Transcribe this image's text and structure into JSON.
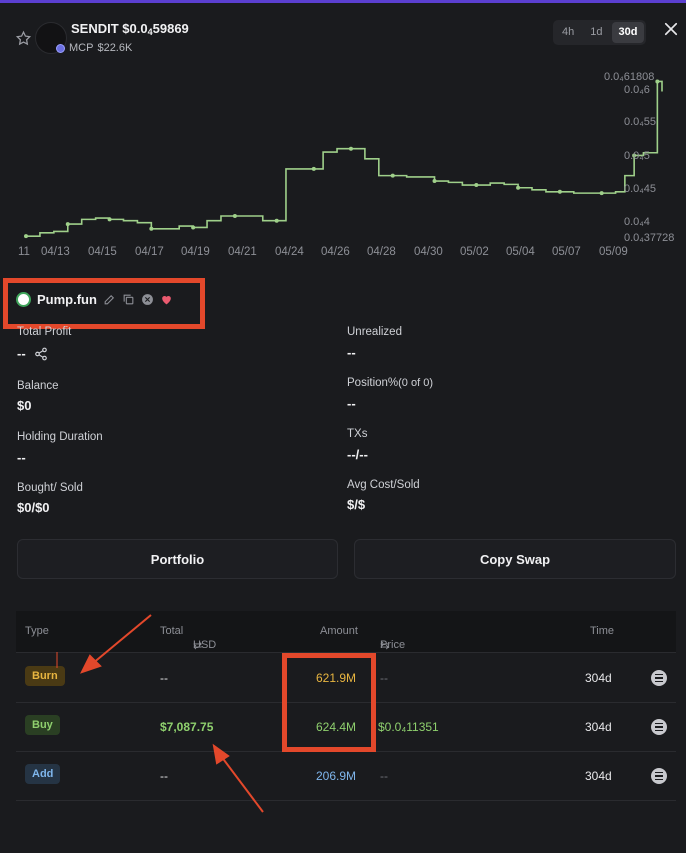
{
  "header": {
    "token_name": "SENDIT",
    "price_prefix": "$0.0",
    "price_sub": "4",
    "price_rest": "59869",
    "mcp_label": "MCP",
    "mcp_value": "$22.6K"
  },
  "timeframes": [
    {
      "label": "4h",
      "active": false
    },
    {
      "label": "1d",
      "active": false
    },
    {
      "label": "30d",
      "active": true
    }
  ],
  "chart_data": {
    "type": "line",
    "x_tick_labels": [
      "11",
      "04/13",
      "04/15",
      "04/17",
      "04/19",
      "04/21",
      "04/24",
      "04/26",
      "04/28",
      "04/30",
      "05/02",
      "05/04",
      "05/07",
      "05/09"
    ],
    "y_tick_labels": [
      "0.0₄61808",
      "0.0₄6",
      "0.0₄55",
      "0.0₄5",
      "0.0₄45",
      "0.0₄4",
      "0.0₄37728"
    ],
    "ylim": [
      3.773e-05,
      6.181e-05
    ],
    "points": [
      [
        0,
        3.8e-05
      ],
      [
        3,
        3.85e-05
      ],
      [
        6,
        3.87e-05
      ],
      [
        9,
        3.98e-05
      ],
      [
        12,
        4.05e-05
      ],
      [
        15,
        4.07e-05
      ],
      [
        18,
        4.05e-05
      ],
      [
        21,
        4.03e-05
      ],
      [
        24,
        4e-05
      ],
      [
        27,
        3.91e-05
      ],
      [
        30,
        3.91e-05
      ],
      [
        33,
        3.95e-05
      ],
      [
        36,
        3.93e-05
      ],
      [
        39,
        4.03e-05
      ],
      [
        42,
        4.1e-05
      ],
      [
        45,
        4.1e-05
      ],
      [
        48,
        4.1e-05
      ],
      [
        51,
        4.03e-05
      ],
      [
        54,
        4.03e-05
      ],
      [
        56,
        4.8e-05
      ],
      [
        59,
        4.8e-05
      ],
      [
        62,
        4.8e-05
      ],
      [
        64,
        5.05e-05
      ],
      [
        67,
        5.1e-05
      ],
      [
        70,
        5.1e-05
      ],
      [
        73,
        4.95e-05
      ],
      [
        76,
        4.7e-05
      ],
      [
        79,
        4.7e-05
      ],
      [
        82,
        4.68e-05
      ],
      [
        85,
        4.68e-05
      ],
      [
        88,
        4.62e-05
      ],
      [
        91,
        4.6e-05
      ],
      [
        94,
        4.56e-05
      ],
      [
        97,
        4.56e-05
      ],
      [
        100,
        4.59e-05
      ],
      [
        103,
        4.57e-05
      ],
      [
        106,
        4.52e-05
      ],
      [
        109,
        4.49e-05
      ],
      [
        112,
        4.46e-05
      ],
      [
        115,
        4.46e-05
      ],
      [
        118,
        4.44e-05
      ],
      [
        121,
        4.44e-05
      ],
      [
        124,
        4.44e-05
      ],
      [
        127,
        4.46e-05
      ],
      [
        129,
        4.7e-05
      ],
      [
        131,
        5e-05
      ],
      [
        133,
        5.04e-05
      ],
      [
        135,
        5.04e-05
      ],
      [
        136,
        6.1e-05
      ],
      [
        137,
        5.95e-05
      ]
    ],
    "line_color": "#9fd08a",
    "grid": false
  },
  "platform": {
    "name": "Pump.fun"
  },
  "stats": {
    "total_profit_label": "Total Profit",
    "total_profit_value": "--",
    "unrealized_label": "Unrealized",
    "unrealized_value": "--",
    "balance_label": "Balance",
    "balance_value": "$0",
    "position_label": "Position%",
    "position_sub": "(0 of 0)",
    "position_value": "--",
    "holding_label": "Holding Duration",
    "holding_value": "--",
    "txs_label": "TXs",
    "txs_value": "--/--",
    "bought_sold_label": "Bought/ Sold",
    "bought_sold_value": "$0/$0",
    "avg_cost_label": "Avg Cost/Sold",
    "avg_cost_value": "$/$"
  },
  "buttons": {
    "portfolio": "Portfolio",
    "copy_swap": "Copy Swap"
  },
  "table": {
    "headers": {
      "type": "Type",
      "total": "Total",
      "usd": "USD",
      "amount": "Amount",
      "price": "Price",
      "time": "Time"
    },
    "rows": [
      {
        "type": "Burn",
        "total": "--",
        "amount": "621.9M",
        "price": "--",
        "time": "304d"
      },
      {
        "type": "Buy",
        "total": "$7,087.75",
        "amount": "624.4M",
        "price": "$0.0₄11351",
        "time": "304d"
      },
      {
        "type": "Add",
        "total": "--",
        "amount": "206.9M",
        "price": "--",
        "time": "304d"
      }
    ]
  },
  "colors": {
    "accent_red": "#e3482b",
    "burn": "#e8b540",
    "buy": "#8fd06e",
    "add": "#7fb6ec"
  }
}
